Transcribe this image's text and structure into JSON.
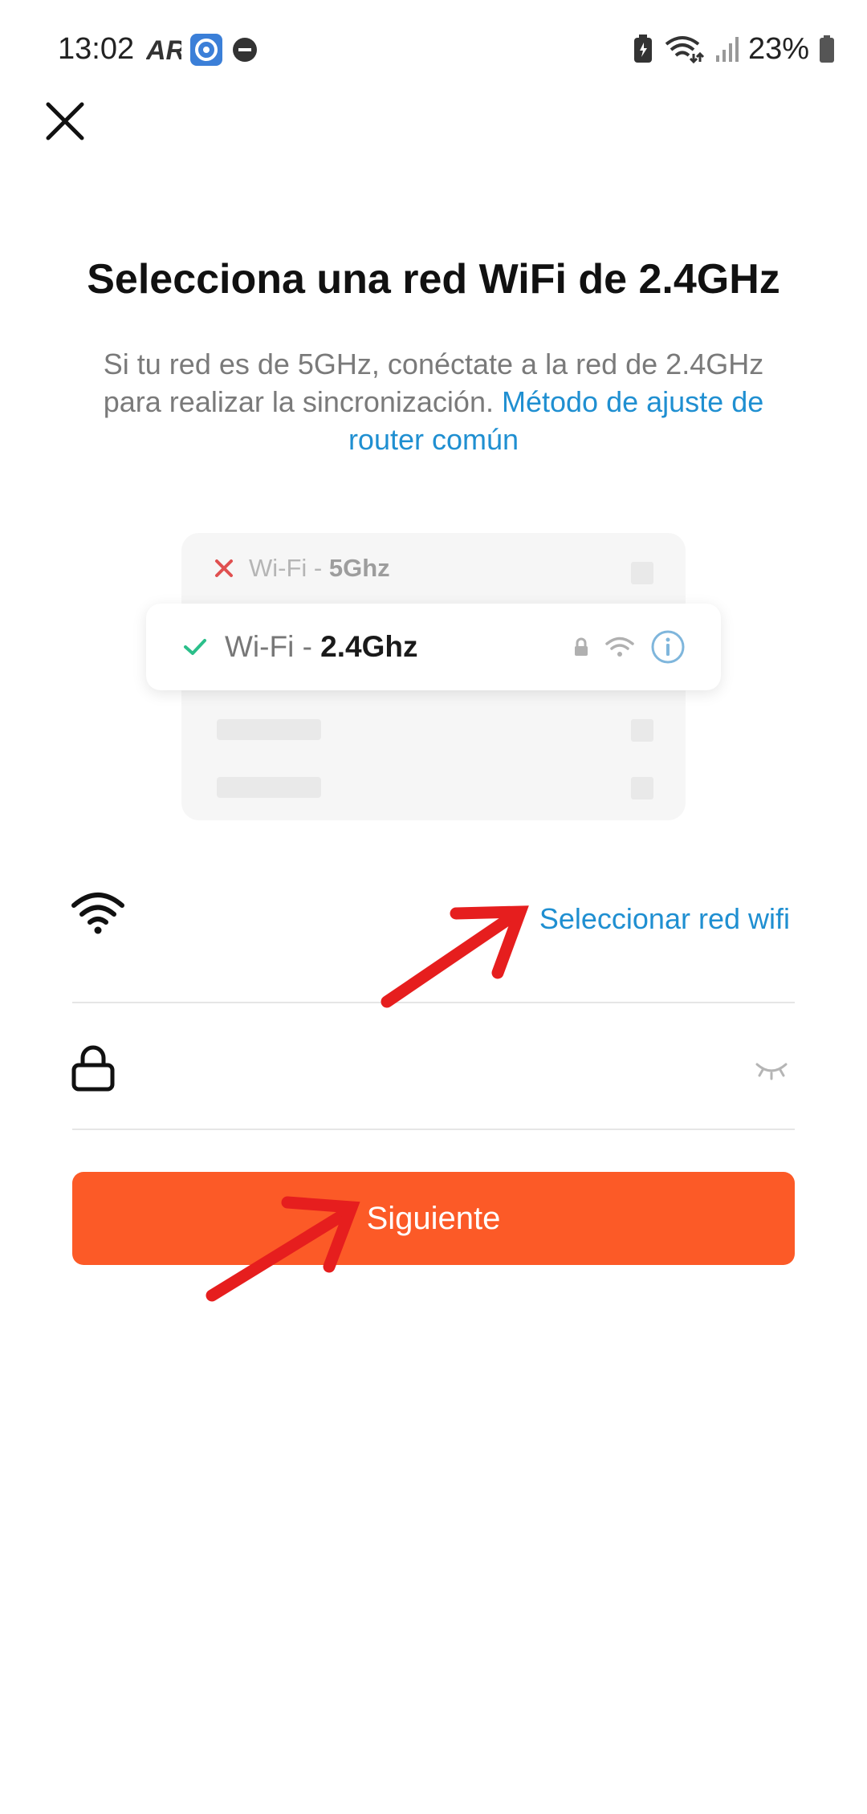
{
  "status_bar": {
    "time": "13:02",
    "battery": "23%",
    "left_icons": [
      "ar-zone-icon",
      "app-notification-icon",
      "do-not-disturb-icon"
    ],
    "right_icons": [
      "battery-saver-icon",
      "wifi-calling-icon",
      "signal-icon",
      "battery-icon"
    ]
  },
  "header": {
    "close_icon": "close-icon"
  },
  "main": {
    "title": "Selecciona una red WiFi de 2.4GHz",
    "subtitle_text": "Si tu red es de 5GHz, conéctate a la red de 2.4GHz para realizar la sincronización.",
    "subtitle_link": "Método de ajuste de router común"
  },
  "illustration": {
    "row_5g": {
      "prefix": "Wi-Fi - ",
      "band": "5Ghz",
      "icon": "cross-icon"
    },
    "row_24g": {
      "prefix": "Wi-Fi - ",
      "band": "2.4Ghz",
      "icon": "check-icon"
    },
    "colors": {
      "cross": "#e05050",
      "check": "#2bbf8a",
      "info": "#7fb6dc"
    }
  },
  "form": {
    "wifi_select_label": "Seleccionar red wifi",
    "wifi_name_value": "",
    "password_value": ""
  },
  "next_button": {
    "label": "Siguiente"
  },
  "colors": {
    "accent": "#fc5a27",
    "link": "#1f8fd1",
    "annotation_arrow": "#e61e1e"
  }
}
